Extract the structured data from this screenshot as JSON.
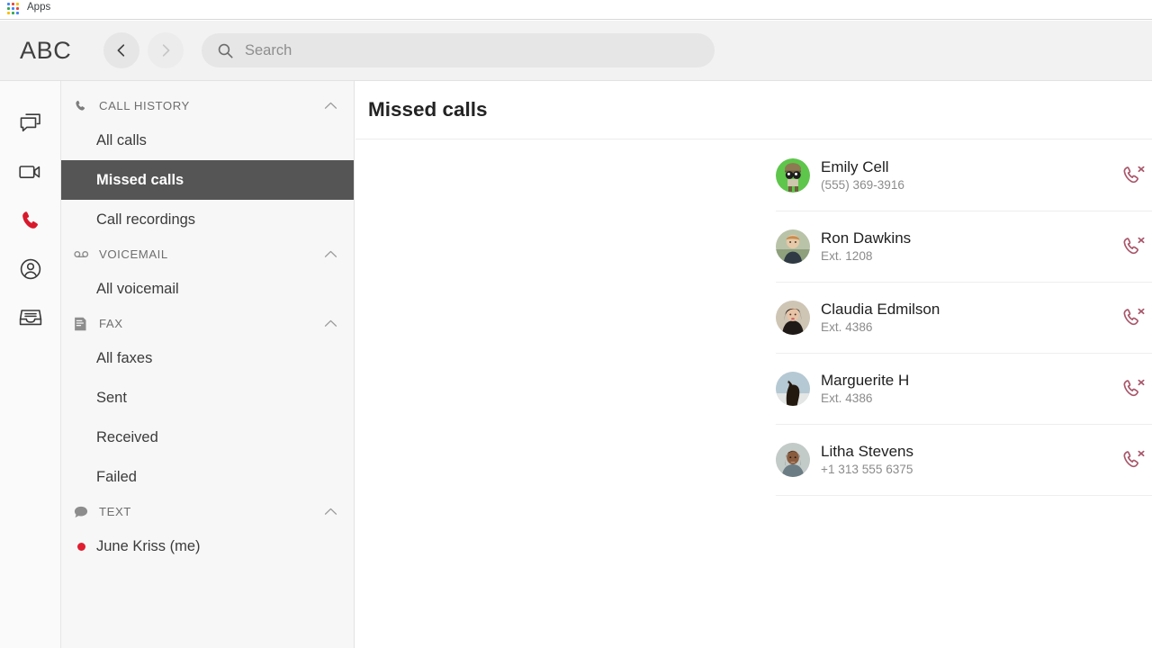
{
  "browser": {
    "bookmark_label": "Apps",
    "bookmark_icon": "apps-grid-icon"
  },
  "topbar": {
    "brand": "ABC",
    "back_icon": "chevron-left-icon",
    "forward_icon": "chevron-right-icon",
    "search_icon": "search-icon",
    "search_value": "",
    "search_placeholder": "Search"
  },
  "rail": {
    "items": [
      {
        "icon": "messages-icon",
        "active": false
      },
      {
        "icon": "video-camera-icon",
        "active": false
      },
      {
        "icon": "phone-icon",
        "active": true
      },
      {
        "icon": "contacts-person-icon",
        "active": false
      },
      {
        "icon": "inbox-tray-icon",
        "active": false
      }
    ]
  },
  "sidebar": {
    "sections": [
      {
        "title": "CALL HISTORY",
        "icon": "phone-icon",
        "collapse_icon": "chevron-up-icon",
        "items": [
          {
            "label": "All calls",
            "active": false
          },
          {
            "label": "Missed calls",
            "active": true
          },
          {
            "label": "Call recordings",
            "active": false
          }
        ]
      },
      {
        "title": "VOICEMAIL",
        "icon": "voicemail-icon",
        "collapse_icon": "chevron-up-icon",
        "items": [
          {
            "label": "All voicemail",
            "active": false
          }
        ]
      },
      {
        "title": "FAX",
        "icon": "fax-icon",
        "collapse_icon": "chevron-up-icon",
        "items": [
          {
            "label": "All faxes",
            "active": false
          },
          {
            "label": "Sent",
            "active": false
          },
          {
            "label": "Received",
            "active": false
          },
          {
            "label": "Failed",
            "active": false
          }
        ]
      },
      {
        "title": "TEXT",
        "icon": "speech-bubble-icon",
        "collapse_icon": "chevron-up-icon",
        "conversations": [
          {
            "label": "June Kriss (me)",
            "unread": true,
            "unread_color": "#e01e30"
          }
        ]
      }
    ]
  },
  "main": {
    "title": "Missed calls",
    "calls": [
      {
        "name": "Emily Cell",
        "detail": "(555) 369-3916",
        "avatar": "avatar-cartoon-green",
        "action_icon": "missed-call-icon"
      },
      {
        "name": "Ron Dawkins",
        "detail": "Ext. 1208",
        "avatar": "avatar-photo-man",
        "action_icon": "missed-call-icon"
      },
      {
        "name": "Claudia Edmilson",
        "detail": "Ext. 4386",
        "avatar": "avatar-photo-woman-dark-hair",
        "action_icon": "missed-call-icon"
      },
      {
        "name": "Marguerite H",
        "detail": "Ext. 4386",
        "avatar": "avatar-photo-horse",
        "action_icon": "missed-call-icon"
      },
      {
        "name": "Litha Stevens",
        "detail": "+1 313 555 6375",
        "avatar": "avatar-photo-woman-smiling",
        "action_icon": "missed-call-icon"
      }
    ]
  },
  "colors": {
    "accent_red": "#d8192c",
    "missed_icon": "#a8566a",
    "active_nav_bg": "#555555",
    "topbar_bg": "#f2f2f2",
    "panel_bg": "#f7f7f7"
  }
}
